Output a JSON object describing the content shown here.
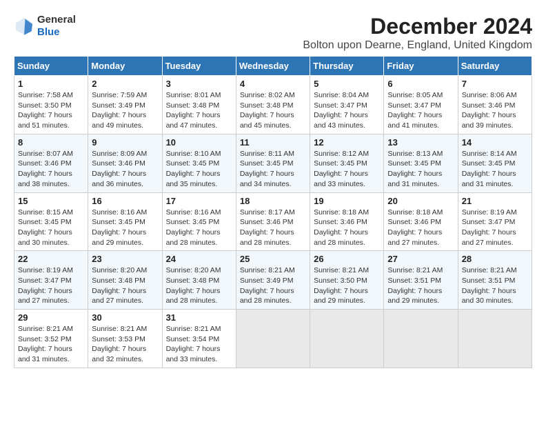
{
  "logo": {
    "line1": "General",
    "line2": "Blue"
  },
  "title": "December 2024",
  "subtitle": "Bolton upon Dearne, England, United Kingdom",
  "days_of_week": [
    "Sunday",
    "Monday",
    "Tuesday",
    "Wednesday",
    "Thursday",
    "Friday",
    "Saturday"
  ],
  "weeks": [
    [
      {
        "day": "1",
        "info": "Sunrise: 7:58 AM\nSunset: 3:50 PM\nDaylight: 7 hours\nand 51 minutes."
      },
      {
        "day": "2",
        "info": "Sunrise: 7:59 AM\nSunset: 3:49 PM\nDaylight: 7 hours\nand 49 minutes."
      },
      {
        "day": "3",
        "info": "Sunrise: 8:01 AM\nSunset: 3:48 PM\nDaylight: 7 hours\nand 47 minutes."
      },
      {
        "day": "4",
        "info": "Sunrise: 8:02 AM\nSunset: 3:48 PM\nDaylight: 7 hours\nand 45 minutes."
      },
      {
        "day": "5",
        "info": "Sunrise: 8:04 AM\nSunset: 3:47 PM\nDaylight: 7 hours\nand 43 minutes."
      },
      {
        "day": "6",
        "info": "Sunrise: 8:05 AM\nSunset: 3:47 PM\nDaylight: 7 hours\nand 41 minutes."
      },
      {
        "day": "7",
        "info": "Sunrise: 8:06 AM\nSunset: 3:46 PM\nDaylight: 7 hours\nand 39 minutes."
      }
    ],
    [
      {
        "day": "8",
        "info": "Sunrise: 8:07 AM\nSunset: 3:46 PM\nDaylight: 7 hours\nand 38 minutes."
      },
      {
        "day": "9",
        "info": "Sunrise: 8:09 AM\nSunset: 3:46 PM\nDaylight: 7 hours\nand 36 minutes."
      },
      {
        "day": "10",
        "info": "Sunrise: 8:10 AM\nSunset: 3:45 PM\nDaylight: 7 hours\nand 35 minutes."
      },
      {
        "day": "11",
        "info": "Sunrise: 8:11 AM\nSunset: 3:45 PM\nDaylight: 7 hours\nand 34 minutes."
      },
      {
        "day": "12",
        "info": "Sunrise: 8:12 AM\nSunset: 3:45 PM\nDaylight: 7 hours\nand 33 minutes."
      },
      {
        "day": "13",
        "info": "Sunrise: 8:13 AM\nSunset: 3:45 PM\nDaylight: 7 hours\nand 31 minutes."
      },
      {
        "day": "14",
        "info": "Sunrise: 8:14 AM\nSunset: 3:45 PM\nDaylight: 7 hours\nand 31 minutes."
      }
    ],
    [
      {
        "day": "15",
        "info": "Sunrise: 8:15 AM\nSunset: 3:45 PM\nDaylight: 7 hours\nand 30 minutes."
      },
      {
        "day": "16",
        "info": "Sunrise: 8:16 AM\nSunset: 3:45 PM\nDaylight: 7 hours\nand 29 minutes."
      },
      {
        "day": "17",
        "info": "Sunrise: 8:16 AM\nSunset: 3:45 PM\nDaylight: 7 hours\nand 28 minutes."
      },
      {
        "day": "18",
        "info": "Sunrise: 8:17 AM\nSunset: 3:46 PM\nDaylight: 7 hours\nand 28 minutes."
      },
      {
        "day": "19",
        "info": "Sunrise: 8:18 AM\nSunset: 3:46 PM\nDaylight: 7 hours\nand 28 minutes."
      },
      {
        "day": "20",
        "info": "Sunrise: 8:18 AM\nSunset: 3:46 PM\nDaylight: 7 hours\nand 27 minutes."
      },
      {
        "day": "21",
        "info": "Sunrise: 8:19 AM\nSunset: 3:47 PM\nDaylight: 7 hours\nand 27 minutes."
      }
    ],
    [
      {
        "day": "22",
        "info": "Sunrise: 8:19 AM\nSunset: 3:47 PM\nDaylight: 7 hours\nand 27 minutes."
      },
      {
        "day": "23",
        "info": "Sunrise: 8:20 AM\nSunset: 3:48 PM\nDaylight: 7 hours\nand 27 minutes."
      },
      {
        "day": "24",
        "info": "Sunrise: 8:20 AM\nSunset: 3:48 PM\nDaylight: 7 hours\nand 28 minutes."
      },
      {
        "day": "25",
        "info": "Sunrise: 8:21 AM\nSunset: 3:49 PM\nDaylight: 7 hours\nand 28 minutes."
      },
      {
        "day": "26",
        "info": "Sunrise: 8:21 AM\nSunset: 3:50 PM\nDaylight: 7 hours\nand 29 minutes."
      },
      {
        "day": "27",
        "info": "Sunrise: 8:21 AM\nSunset: 3:51 PM\nDaylight: 7 hours\nand 29 minutes."
      },
      {
        "day": "28",
        "info": "Sunrise: 8:21 AM\nSunset: 3:51 PM\nDaylight: 7 hours\nand 30 minutes."
      }
    ],
    [
      {
        "day": "29",
        "info": "Sunrise: 8:21 AM\nSunset: 3:52 PM\nDaylight: 7 hours\nand 31 minutes."
      },
      {
        "day": "30",
        "info": "Sunrise: 8:21 AM\nSunset: 3:53 PM\nDaylight: 7 hours\nand 32 minutes."
      },
      {
        "day": "31",
        "info": "Sunrise: 8:21 AM\nSunset: 3:54 PM\nDaylight: 7 hours\nand 33 minutes."
      },
      null,
      null,
      null,
      null
    ]
  ]
}
